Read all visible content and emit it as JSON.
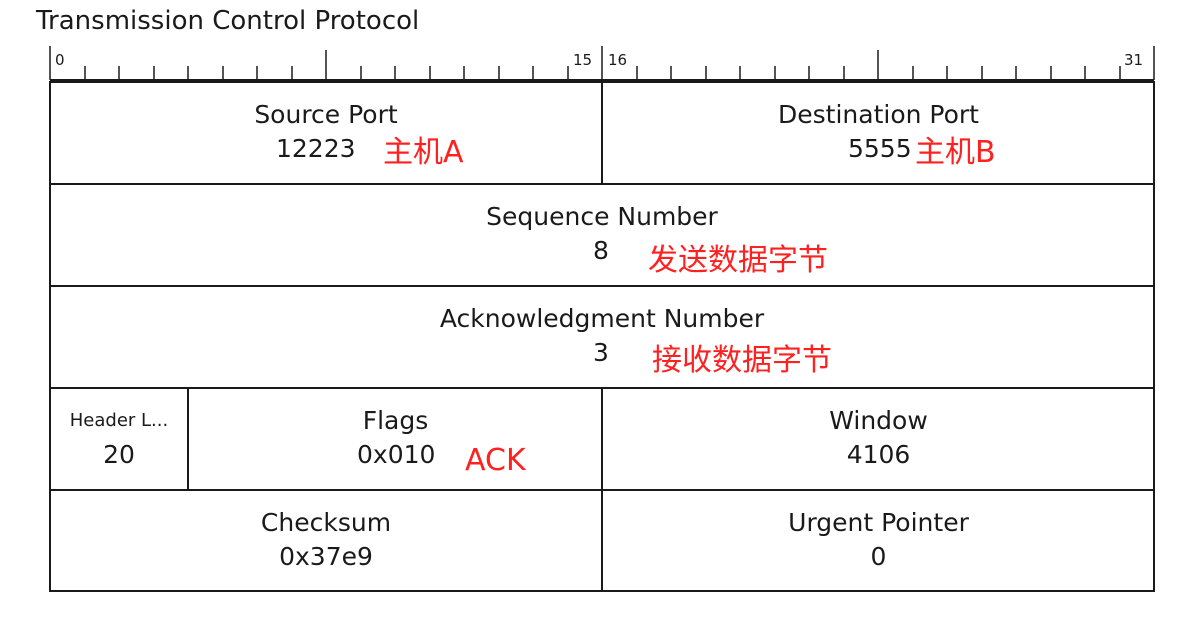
{
  "title": "Transmission Control Protocol",
  "ruler": {
    "labels": [
      "0",
      "15",
      "16",
      "31"
    ]
  },
  "fields": {
    "source_port": {
      "name": "Source Port",
      "value": "12223",
      "note": "主机A"
    },
    "destination_port": {
      "name": "Destination Port",
      "value": "5555",
      "note": "主机B"
    },
    "sequence_number": {
      "name": "Sequence Number",
      "value": "8",
      "note": "发送数据字节"
    },
    "ack_number": {
      "name": "Acknowledgment Number",
      "value": "3",
      "note": "接收数据字节"
    },
    "header_length": {
      "name": "Header L...",
      "value": "20"
    },
    "flags": {
      "name": "Flags",
      "value": "0x010",
      "note": "ACK"
    },
    "window": {
      "name": "Window",
      "value": "4106"
    },
    "checksum": {
      "name": "Checksum",
      "value": "0x37e9"
    },
    "urgent_pointer": {
      "name": "Urgent Pointer",
      "value": "0"
    }
  },
  "colors": {
    "annotation": "#ff2020",
    "lines": "#1a1a1a"
  }
}
